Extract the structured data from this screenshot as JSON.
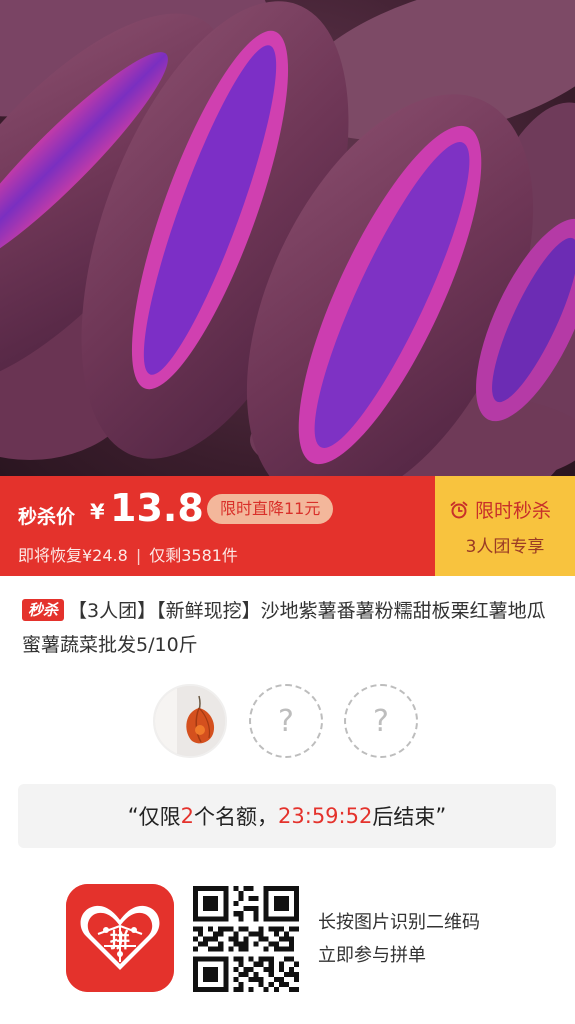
{
  "hero": {
    "image": "purple-sweet-potatoes-photo"
  },
  "price": {
    "label": "秒杀价",
    "currency": "¥",
    "value": "13.8",
    "drop_badge": "限时直降11元",
    "restore_text": "即将恢复¥24.8",
    "separator": "|",
    "stock_text": "仅剩3581件",
    "flash_title": "限时秒杀",
    "flash_sub": "3人团专享"
  },
  "colors": {
    "brand_red": "#e4322c",
    "flash_yellow": "#f8c33e",
    "badge_pink": "#f3b79b"
  },
  "product": {
    "tag": "秒杀",
    "title": "【3人团】【新鲜现挖】沙地紫薯番薯粉糯甜板栗红薯地瓜蜜薯蔬菜批发5/10斤"
  },
  "group": {
    "host_icon": "avatar-physalis-photo",
    "empty_slot": "?"
  },
  "countdown": {
    "open_quote": "“",
    "prefix": "仅限",
    "count": "2",
    "middle": "个名额，",
    "time": "23:59:52",
    "suffix": "后结束",
    "close_quote": "”"
  },
  "footer": {
    "logo_char": "拼",
    "line1": "长按图片识别二维码",
    "line2": "立即参与拼单"
  }
}
